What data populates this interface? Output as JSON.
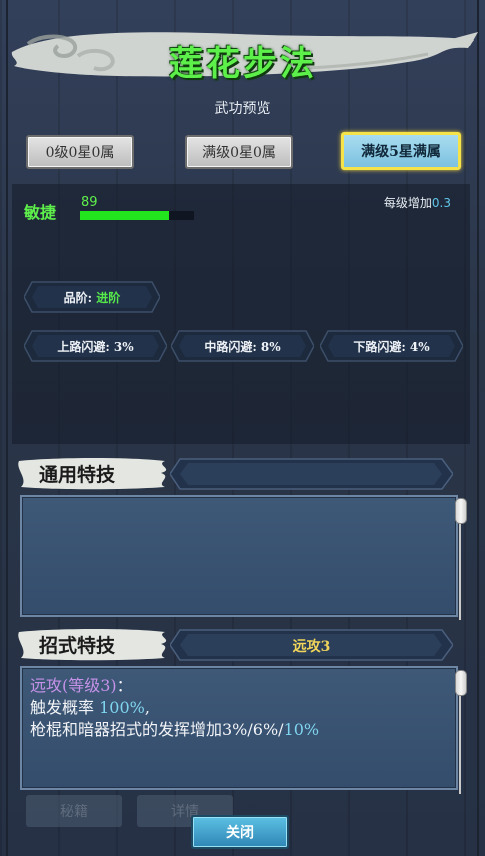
{
  "title": "莲花步法",
  "subtitle": "武功预览",
  "level_buttons": [
    {
      "label": "0级0星0属",
      "active": false
    },
    {
      "label": "满级0星0属",
      "active": false
    },
    {
      "label": "满级5星满属",
      "active": true
    }
  ],
  "stat": {
    "name": "敏捷",
    "value": "89",
    "bar_fraction": 0.78,
    "per_level_label": "每级增加",
    "per_level_value": "0.3"
  },
  "grade": {
    "label": "品阶:",
    "value": "进阶"
  },
  "dodges": [
    {
      "label": "上路闪避: 3%"
    },
    {
      "label": "中路闪避: 8%"
    },
    {
      "label": "下路闪避: 4%"
    }
  ],
  "general_skill": {
    "header": "通用特技",
    "bar_text": ""
  },
  "move_skill": {
    "header": "招式特技",
    "bar_text": "远攻3",
    "line1": "远攻(等级3)",
    "line1_suffix": "：",
    "line2_prefix": "触发概率 ",
    "line2_value": "100%",
    "line2_suffix": ",",
    "line3_prefix": "枪棍和暗器招式的发挥增加3%/6%/",
    "line3_value": "10%"
  },
  "footer": {
    "ghost_left": "秘籍",
    "ghost_right": "详情",
    "close_label": "关闭"
  },
  "colors": {
    "green": "#5ef04a",
    "gold": "#f0d55a",
    "cyan": "#7fd4ee",
    "purple": "#c592e8"
  }
}
